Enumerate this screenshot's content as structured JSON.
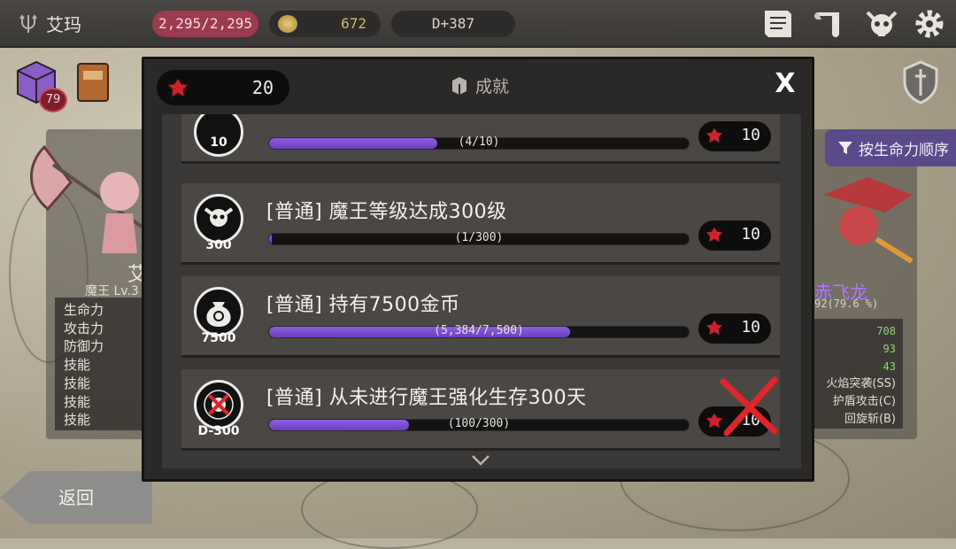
{
  "topbar": {
    "character_name": "艾玛",
    "hp": "2,295/2,295",
    "gold": "672",
    "day": "D+387"
  },
  "left_panel": {
    "chest_badge": "79",
    "name_fragment": "艾",
    "title_level": "魔王 Lv.3",
    "stats_labels": [
      "生命力",
      "攻击力",
      "防御力",
      "技能",
      "技能",
      "技能",
      "技能"
    ]
  },
  "right_panel": {
    "sort_button": "按生命力顺序",
    "monster_name": "赤飞龙",
    "hp_text": "92(79.6 %)",
    "stat_values": [
      "708",
      "93",
      "43"
    ],
    "skills": [
      "火焰突袭(SS)",
      "护盾攻击(C)",
      "回旋斩(B)"
    ]
  },
  "back_button": "返回",
  "modal": {
    "gem_total": "20",
    "title": "成就",
    "close": "X",
    "rows": [
      {
        "icon_label": "10",
        "title": "",
        "progress_text": "(4/10)",
        "progress": 0.4,
        "reward": "10",
        "failed": false
      },
      {
        "icon_label": "300",
        "title": "[普通] 魔王等级达成300级",
        "progress_text": "(1/300)",
        "progress": 0.0033,
        "reward": "10",
        "failed": false
      },
      {
        "icon_label": "7500",
        "title": "[普通] 持有7500金币",
        "progress_text": "(5,384/7,500)",
        "progress": 0.718,
        "reward": "10",
        "failed": false
      },
      {
        "icon_label": "D-300",
        "title": "[普通] 从未进行魔王强化生存300天",
        "progress_text": "(100/300)",
        "progress": 0.333,
        "reward": "10",
        "failed": true
      }
    ]
  },
  "colors": {
    "hp_pill": "#9c3a4e",
    "progress_fill": "#7a4fd0",
    "sort_button": "#5a4a8a",
    "monster_name": "#b176ff",
    "gem_red": "#d0202a",
    "fail_mark": "#e0242a"
  },
  "icons": [
    "trident-icon",
    "gold-coin-icon",
    "journal-icon",
    "scroll-icon",
    "demon-skull-icon",
    "gear-icon",
    "chest-icon",
    "spellbook-icon",
    "shield-sword-icon",
    "filter-icon",
    "red-gem-icon",
    "achievement-box-icon",
    "close-icon",
    "chevron-up-icon",
    "chevron-down-icon"
  ]
}
